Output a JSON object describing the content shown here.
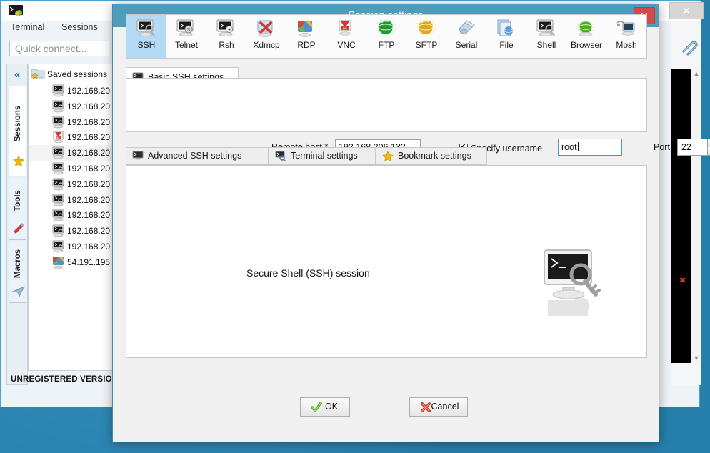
{
  "desktop": {
    "background_color": "#2b8fc2"
  },
  "background_window": {
    "app_icon": "mobaxterm-logo-icon",
    "menu": [
      {
        "label": "Terminal"
      },
      {
        "label": "Sessions"
      }
    ],
    "quick_connect": {
      "placeholder": "Quick connect..."
    },
    "ribbon": {
      "collapse_label": "«",
      "tabs": [
        {
          "label": "Sessions",
          "icon": "star-icon"
        },
        {
          "label": "Tools",
          "icon": "swiss-knife-icon"
        },
        {
          "label": "Macros",
          "icon": "paper-plane-icon"
        }
      ]
    },
    "session_tree": {
      "root_label": "Saved sessions",
      "root_icon": "folder-star-icon",
      "items": [
        {
          "label": "192.168.20",
          "icon": "ssh-session-icon"
        },
        {
          "label": "192.168.20",
          "icon": "ssh-session-icon"
        },
        {
          "label": "192.168.20",
          "icon": "ssh-session-icon"
        },
        {
          "label": "192.168.20",
          "icon": "vnc-session-icon"
        },
        {
          "label": "192.168.20",
          "icon": "ssh-session-icon"
        },
        {
          "label": "192.168.20",
          "icon": "ssh-session-icon"
        },
        {
          "label": "192.168.20",
          "icon": "ssh-session-icon"
        },
        {
          "label": "192.168.20",
          "icon": "ssh-session-icon"
        },
        {
          "label": "192.168.20",
          "icon": "ssh-session-icon"
        },
        {
          "label": "192.168.20",
          "icon": "ssh-session-icon"
        },
        {
          "label": "192.168.20",
          "icon": "ssh-session-icon"
        },
        {
          "label": "54.191.195",
          "icon": "rdp-session-icon"
        }
      ]
    },
    "status_text": "UNREGISTERED VERSION",
    "close_button": "✕",
    "attach_icon": "paperclip-icon",
    "terminal": {
      "background_color": "#000000",
      "marker": "✖"
    },
    "scrollbar": {
      "up": "▲",
      "down": "▼"
    }
  },
  "dialog": {
    "title": "Session settings",
    "close_label": "✕",
    "title_bar_color": "#4e9cb8",
    "close_button_color": "#cf4a49",
    "protocols": [
      {
        "label": "SSH",
        "icon": "ssh-icon",
        "selected": true
      },
      {
        "label": "Telnet",
        "icon": "telnet-icon",
        "selected": false
      },
      {
        "label": "Rsh",
        "icon": "rsh-icon",
        "selected": false
      },
      {
        "label": "Xdmcp",
        "icon": "xdmcp-icon",
        "selected": false
      },
      {
        "label": "RDP",
        "icon": "rdp-icon",
        "selected": false
      },
      {
        "label": "VNC",
        "icon": "vnc-icon",
        "selected": false
      },
      {
        "label": "FTP",
        "icon": "ftp-icon",
        "selected": false
      },
      {
        "label": "SFTP",
        "icon": "sftp-icon",
        "selected": false
      },
      {
        "label": "Serial",
        "icon": "serial-icon",
        "selected": false
      },
      {
        "label": "File",
        "icon": "file-icon",
        "selected": false
      },
      {
        "label": "Shell",
        "icon": "shell-icon",
        "selected": false
      },
      {
        "label": "Browser",
        "icon": "browser-icon",
        "selected": false
      },
      {
        "label": "Mosh",
        "icon": "mosh-icon",
        "selected": false
      }
    ],
    "basic_tab": {
      "label": "Basic SSH settings",
      "icon": "monitor-icon"
    },
    "form": {
      "remote_host_label": "Remote host *",
      "remote_host_value": "192.168.206.132",
      "specify_username_label": "Specify username",
      "specify_username_checked": true,
      "username_value": "root",
      "port_label": "Port",
      "port_value": "22",
      "spinner_up": "▲",
      "spinner_down": "▼"
    },
    "sub_tabs": [
      {
        "label": "Advanced SSH settings",
        "icon": "monitor-icon",
        "active": false
      },
      {
        "label": "Terminal settings",
        "icon": "terminal-magnifier-icon",
        "active": false
      },
      {
        "label": "Bookmark settings",
        "icon": "star-icon",
        "active": false
      }
    ],
    "panel_caption": "Secure Shell (SSH) session",
    "panel_icon": "ssh-terminal-key-icon",
    "buttons": {
      "ok_label": "OK",
      "ok_icon": "green-check-icon",
      "cancel_label": "Cancel",
      "cancel_icon": "red-cross-icon"
    }
  }
}
